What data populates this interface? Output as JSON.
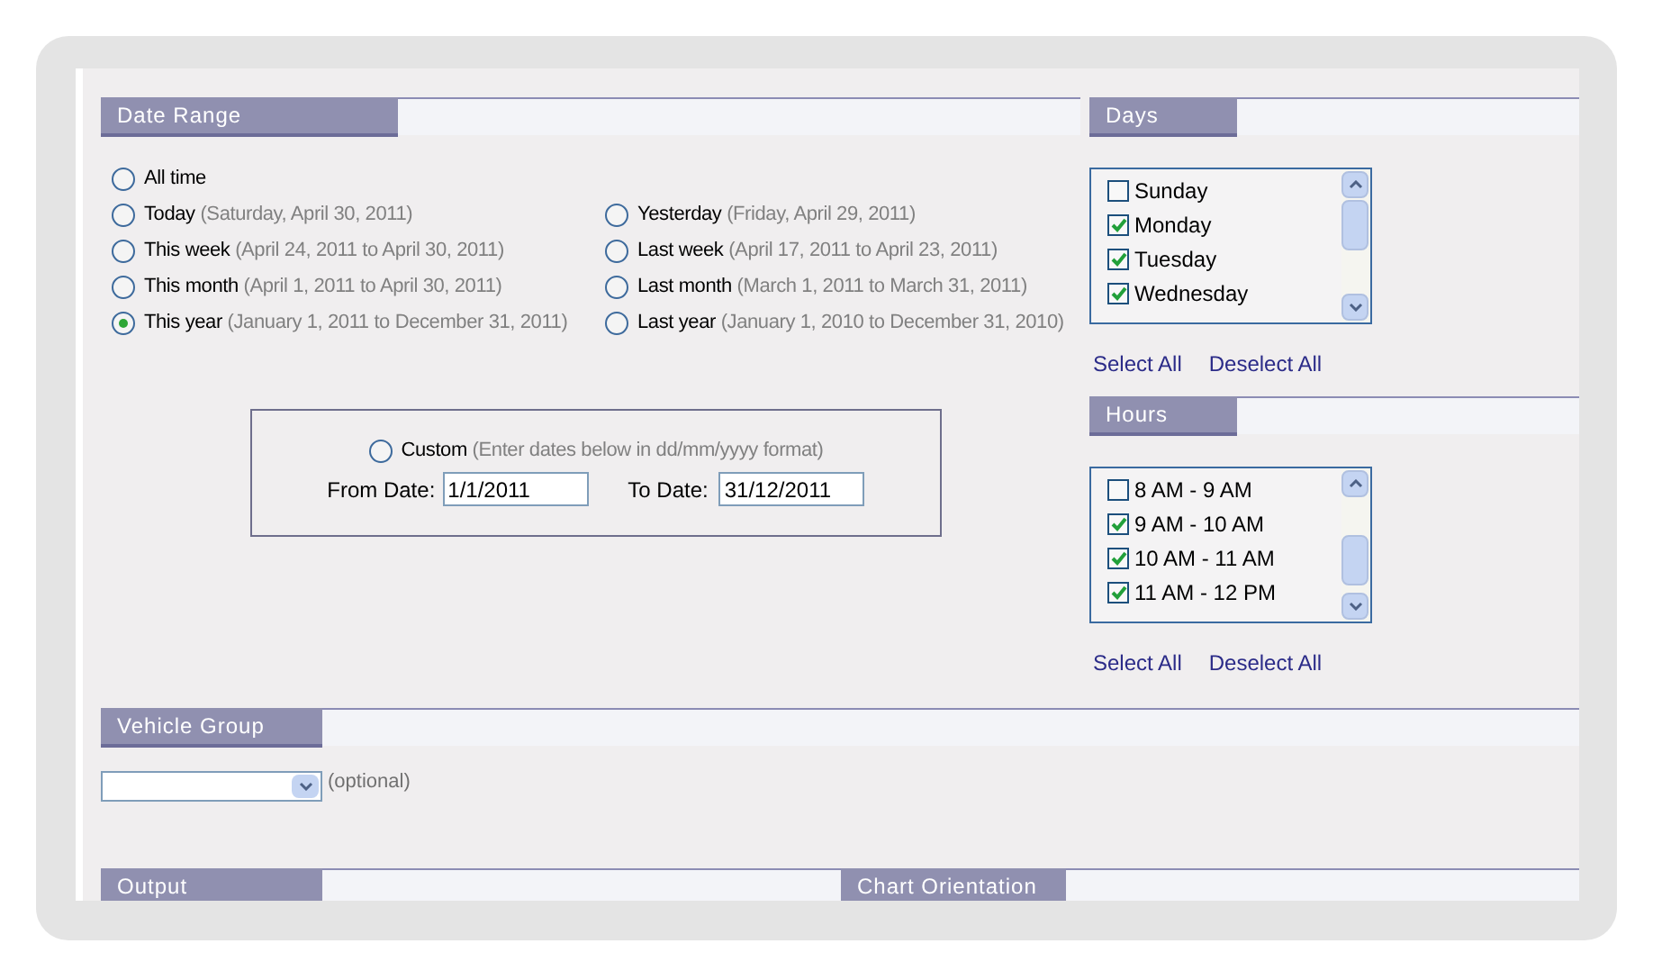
{
  "date_range": {
    "title": "Date Range",
    "left_options": [
      {
        "label": "All time",
        "selected": false
      },
      {
        "label": "Today",
        "detail": "(Saturday, April 30, 2011)",
        "selected": false
      },
      {
        "label": "This week",
        "detail": "(April 24, 2011 to April 30, 2011)",
        "selected": false
      },
      {
        "label": "This month",
        "detail": "(April 1, 2011 to April 30, 2011)",
        "selected": false
      },
      {
        "label": "This year",
        "detail": "(January 1, 2011 to December 31, 2011)",
        "selected": true
      }
    ],
    "right_options": [
      {
        "label": "Yesterday",
        "detail": "(Friday, April 29, 2011)",
        "selected": false
      },
      {
        "label": "Last week",
        "detail": "(April 17, 2011 to April 23, 2011)",
        "selected": false
      },
      {
        "label": "Last month",
        "detail": "(March 1, 2011 to March 31, 2011)",
        "selected": false
      },
      {
        "label": "Last year",
        "detail": "(January 1, 2010 to December 31, 2010)",
        "selected": false
      }
    ],
    "custom": {
      "label": "Custom",
      "detail": "(Enter dates below in dd/mm/yyyy format)",
      "selected": false,
      "from_label": "From Date:",
      "from_value": "1/1/2011",
      "to_label": "To Date:",
      "to_value": "31/12/2011"
    }
  },
  "days": {
    "title": "Days",
    "items": [
      {
        "label": "Sunday",
        "checked": false
      },
      {
        "label": "Monday",
        "checked": true
      },
      {
        "label": "Tuesday",
        "checked": true
      },
      {
        "label": "Wednesday",
        "checked": true
      }
    ],
    "select_all": "Select All",
    "deselect_all": "Deselect All"
  },
  "hours": {
    "title": "Hours",
    "items": [
      {
        "label": "8 AM - 9 AM",
        "checked": false
      },
      {
        "label": "9 AM - 10 AM",
        "checked": true
      },
      {
        "label": "10 AM - 11 AM",
        "checked": true
      },
      {
        "label": "11 AM - 12 PM",
        "checked": true
      }
    ],
    "select_all": "Select All",
    "deselect_all": "Deselect All"
  },
  "vehicle_group": {
    "title": "Vehicle Group",
    "note": "(optional)"
  },
  "output": {
    "title": "Output"
  },
  "chart_orientation": {
    "title": "Chart Orientation"
  }
}
